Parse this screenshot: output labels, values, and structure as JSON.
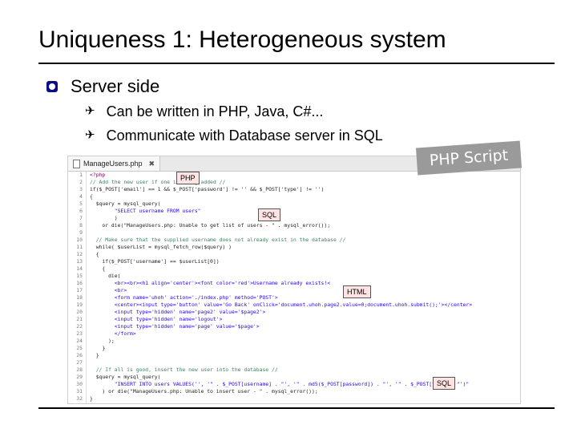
{
  "title": "Uniqueness 1: Heterogeneous system",
  "bullet": "Server side",
  "sub_bullets": [
    "Can be written in PHP, Java, C#...",
    "Communicate with Database server in SQL"
  ],
  "script_label": "PHP Script",
  "editor": {
    "tab_name": "ManageUsers.php",
    "tab_close": "✖"
  },
  "labels": {
    "php": "PHP",
    "sql1": "SQL",
    "html": "HTML",
    "sql2": "SQL"
  },
  "code_lines": [
    {
      "n": "1",
      "t": "<?php",
      "k": "keyword"
    },
    {
      "n": "2",
      "t": "// Add the new user if one is being added //",
      "k": "comment"
    },
    {
      "n": "3",
      "t": "if($_POST['email'] == 1 && $_POST['password'] != '' && $_POST['type'] != '')",
      "k": ""
    },
    {
      "n": "4",
      "t": "{",
      "k": ""
    },
    {
      "n": "5",
      "t": "  $query = mysql_query(",
      "k": ""
    },
    {
      "n": "6",
      "t": "        \"SELECT username FROM users\"",
      "k": "string"
    },
    {
      "n": "7",
      "t": "        )",
      "k": ""
    },
    {
      "n": "8",
      "t": "    or die(\"ManageUsers.php: Unable to get list of users - \" . mysql_error());",
      "k": ""
    },
    {
      "n": "9",
      "t": "",
      "k": ""
    },
    {
      "n": "10",
      "t": "  // Make sure that the supplied username does not already exist in the database //",
      "k": "comment"
    },
    {
      "n": "11",
      "t": "  while( $userList = mysql_fetch_row($query) )",
      "k": ""
    },
    {
      "n": "12",
      "t": "  {",
      "k": ""
    },
    {
      "n": "13",
      "t": "    if($_POST['username'] == $userList[0])",
      "k": ""
    },
    {
      "n": "14",
      "t": "    {",
      "k": ""
    },
    {
      "n": "15",
      "t": "      die(",
      "k": ""
    },
    {
      "n": "16",
      "t": "        <br><br><h1 align='center'><font color='red'>Username already exists!<",
      "k": "string"
    },
    {
      "n": "17",
      "t": "        <br>",
      "k": "string"
    },
    {
      "n": "18",
      "t": "        <form name='uhoh' action='./index.php' method='POST'>",
      "k": "string"
    },
    {
      "n": "19",
      "t": "        <center><input type='button' value='Go Back' onClick='document.uhoh.page2.value=0;document.uhoh.submit();'></center>",
      "k": "string"
    },
    {
      "n": "20",
      "t": "        <input type='hidden' name='page2' value='$page2'>",
      "k": "string"
    },
    {
      "n": "21",
      "t": "        <input type='hidden' name='logout'>",
      "k": "string"
    },
    {
      "n": "22",
      "t": "        <input type='hidden' name='page' value='$page'>",
      "k": "string"
    },
    {
      "n": "23",
      "t": "        </form>",
      "k": "string"
    },
    {
      "n": "24",
      "t": "      );",
      "k": ""
    },
    {
      "n": "25",
      "t": "    }",
      "k": ""
    },
    {
      "n": "26",
      "t": "  }",
      "k": ""
    },
    {
      "n": "27",
      "t": "",
      "k": ""
    },
    {
      "n": "28",
      "t": "  // If all is good, insert the new user into the database //",
      "k": "comment"
    },
    {
      "n": "29",
      "t": "  $query = mysql_query(",
      "k": ""
    },
    {
      "n": "30",
      "t": "        \"INSERT INTO users VALUES('', '\" . $_POST[username] . \"', '\" . md5($_POST[password]) . \"', '\" . $_POST[type] . \"')\"",
      "k": "string"
    },
    {
      "n": "31",
      "t": "    ) or die(\"ManageUsers.php: Unable to insert user - \" . mysql_error());",
      "k": ""
    },
    {
      "n": "32",
      "t": "}",
      "k": ""
    },
    {
      "n": "33",
      "t": "?>",
      "k": "keyword"
    }
  ]
}
